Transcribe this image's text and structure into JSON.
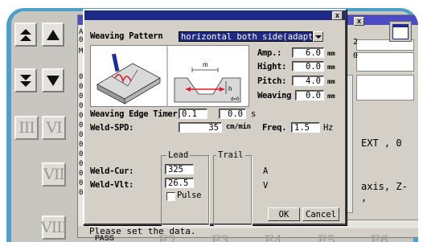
{
  "dialog": {
    "weaving_pattern_label": "Weaving Pattern",
    "weaving_pattern_value": "horizontal both side(adaptiv",
    "amp_label": "Amp.:",
    "amp_value": "6.0",
    "amp_unit": "mm",
    "hight_label": "Hight:",
    "hight_value": "0.0",
    "hight_unit": "mm",
    "pitch_label": "Pitch:",
    "pitch_value": "4.0",
    "pitch_unit": "mm",
    "weaving_label": "Weaving",
    "weaving_value": "0.0",
    "weaving_unit": "mm",
    "edge_timer_label": "Weaving Edge Timer",
    "edge_timer_value1": "0.1",
    "edge_timer_value2": "0.0",
    "edge_timer_unit": "s",
    "weld_spd_label": "Weld-SPD:",
    "weld_spd_value": "35",
    "weld_spd_unit": "cm/min",
    "freq_label": "Freq.",
    "freq_value": "1.5",
    "freq_unit": "Hz",
    "lead_label": "Lead",
    "trail_label": "Trail",
    "weld_cur_label": "Weld-Cur:",
    "weld_cur_value": "325",
    "weld_cur_unit": "A",
    "weld_vlt_label": "Weld-Vlt:",
    "weld_vlt_value": "26.5",
    "weld_vlt_unit": "V",
    "pulse_label": "Pulse",
    "ok_label": "OK",
    "cancel_label": "Cancel",
    "close_label": "x",
    "diagram_m_label": "m",
    "diagram_h_label": "h",
    "diagram_d_label": "d=0"
  },
  "background": {
    "close_label": "x",
    "status_text": "Please set the data.",
    "right_text1": "EXT , 0",
    "right_text2": "axis, Z- ,",
    "num_right1": "2",
    "num_right2": "0",
    "left_col": [
      "AL",
      "0",
      "M",
      "0",
      "0",
      "0",
      "0",
      "0",
      "0",
      "0",
      "0",
      "0",
      "0",
      "0",
      "0",
      "0"
    ]
  },
  "pendant": {
    "roman_keys": [
      "III",
      "VI",
      "VII",
      "VIII"
    ],
    "function_keys": [
      "F2",
      "F3",
      "F4",
      "F5",
      "F6"
    ],
    "pass_label": "PASS"
  },
  "colors": {
    "frame": "#4aa0c9",
    "title_bar": "#1f2a86",
    "dialog_bg": "#d4d0c8"
  }
}
